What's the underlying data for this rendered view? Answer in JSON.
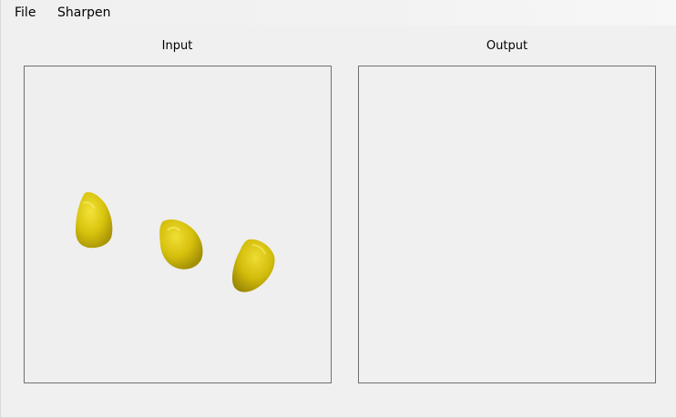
{
  "menu": {
    "file_label": "File",
    "sharpen_label": "Sharpen"
  },
  "panels": {
    "input_title": "Input",
    "output_title": "Output"
  },
  "input_image": {
    "content": "three-corn-kernels",
    "kernel_color": "#d9c20a"
  }
}
